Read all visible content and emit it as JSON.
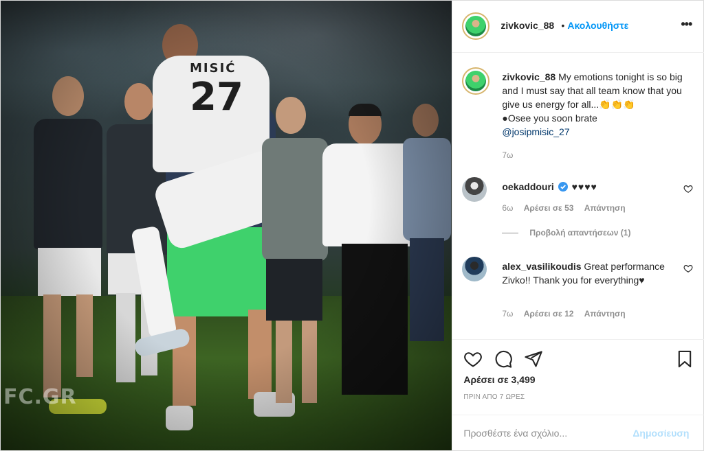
{
  "post": {
    "username": "zivkovic_88",
    "dot": "•",
    "follow_label": "Ακολουθήστε",
    "more_label": "•••",
    "photo_watermark": "FC.GR"
  },
  "caption": {
    "username": "zivkovic_88",
    "text_line1": " My emotions tonight is so big and I must say that all team know that you give us energy for all...",
    "emoji": "👏👏👏",
    "text_line2": "●Osee you soon brate",
    "mention": "@josipmisic_27",
    "time": "7ω"
  },
  "comments": [
    {
      "username": "oekaddouri",
      "verified": true,
      "text": "♥♥♥♥",
      "time": "6ω",
      "likes_label": "Αρέσει σε 53",
      "reply_label": "Απάντηση",
      "view_replies_label": "Προβολή απαντήσεων (1)"
    },
    {
      "username": "alex_vasilikoudis",
      "text": " Great performance Zivko!! Thank you for everything♥",
      "time": "7ω",
      "likes_label": "Αρέσει σε 12",
      "reply_label": "Απάντηση"
    }
  ],
  "actions": {
    "like_icon": "heart-icon",
    "comment_icon": "comment-icon",
    "share_icon": "share-icon",
    "save_icon": "bookmark-icon",
    "likes_label": "Αρέσει σε 3,499",
    "time_ago": "ΠΡΙΝ ΑΠΟ 7 ΩΡΕΣ"
  },
  "add_comment": {
    "placeholder": "Προσθέστε ένα σχόλιο...",
    "post_label": "Δημοσίευση"
  },
  "colors": {
    "link_blue": "#0095f6",
    "muted": "#8e8e8e",
    "post_disabled": "#b2dffc",
    "jersey_green": "#3fd16c"
  }
}
